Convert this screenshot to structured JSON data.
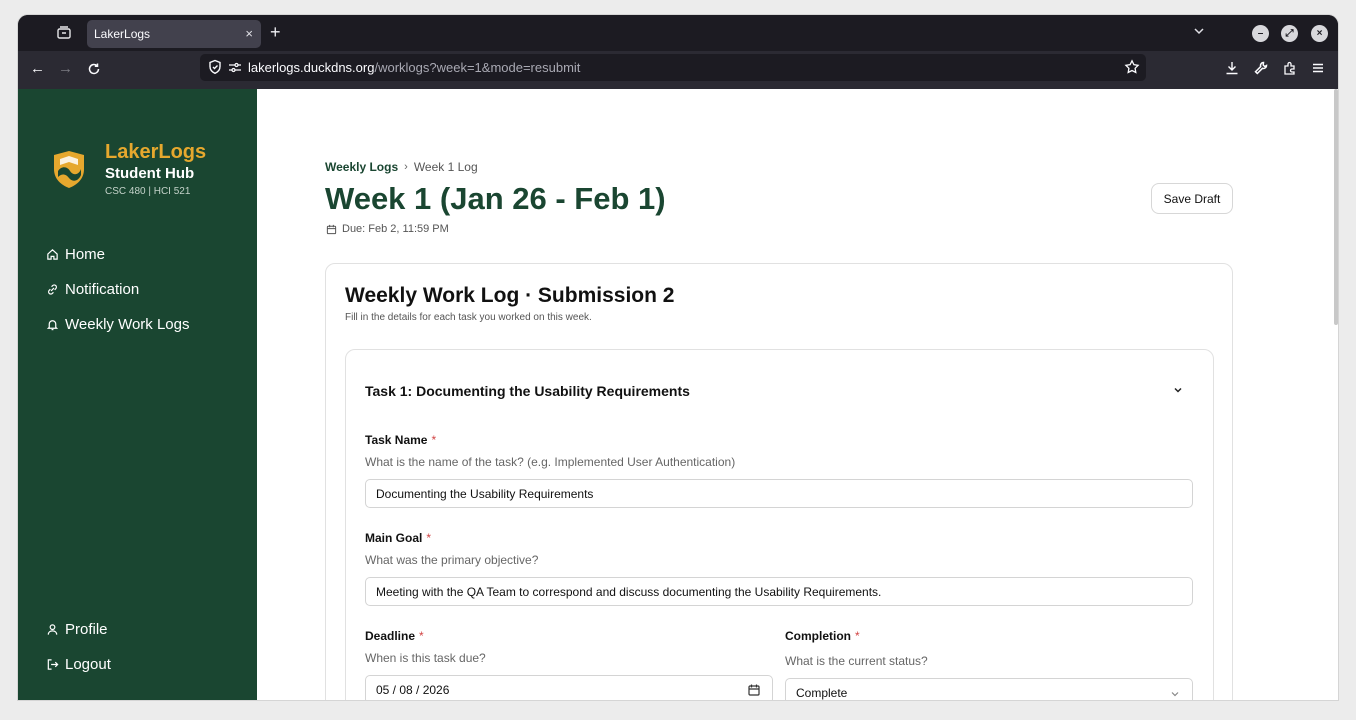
{
  "browser": {
    "tab_title": "LakerLogs",
    "tab_close": "×",
    "new_tab": "+",
    "url_host": "lakerlogs.duckdns.org",
    "url_path": "/worklogs?week=1&mode=resubmit"
  },
  "sidebar": {
    "brand_name": "LakerLogs",
    "brand_sub": "Student Hub",
    "course": "CSC 480 | HCI 521",
    "nav": [
      {
        "label": "Home",
        "icon": "home-icon"
      },
      {
        "label": "Notification",
        "icon": "link-icon"
      },
      {
        "label": "Weekly Work Logs",
        "icon": "bell-icon"
      }
    ],
    "bottom": [
      {
        "label": "Profile",
        "icon": "person-icon"
      },
      {
        "label": "Logout",
        "icon": "logout-icon"
      }
    ]
  },
  "page": {
    "breadcrumb_link": "Weekly Logs",
    "breadcrumb_sep": "›",
    "breadcrumb_current": "Week 1 Log",
    "title": "Week 1 (Jan 26 - Feb 1)",
    "due": "Due: Feb 2, 11:59 PM",
    "save_draft": "Save Draft"
  },
  "card": {
    "title": "Weekly Work Log · Submission 2",
    "subtitle": "Fill in the details for each task you worked on this week."
  },
  "task": {
    "title": "Task 1: Documenting the Usability Requirements",
    "fields": {
      "task_name": {
        "label": "Task Name",
        "help": "What is the name of the task? (e.g. Implemented User Authentication)",
        "value": "Documenting the Usability Requirements"
      },
      "main_goal": {
        "label": "Main Goal",
        "help": "What was the primary objective?",
        "value": "Meeting with the QA Team to correspond and discuss documenting the Usability Requirements."
      },
      "deadline": {
        "label": "Deadline",
        "help": "When is this task due?",
        "value": "05 / 08 / 2026"
      },
      "completion": {
        "label": "Completion",
        "help": "What is the current status?",
        "value": "Complete"
      }
    },
    "required_mark": "*"
  },
  "colors": {
    "sidebar_bg": "#1a4631",
    "brand_gold": "#e6a82e",
    "required_red": "#d14343"
  }
}
